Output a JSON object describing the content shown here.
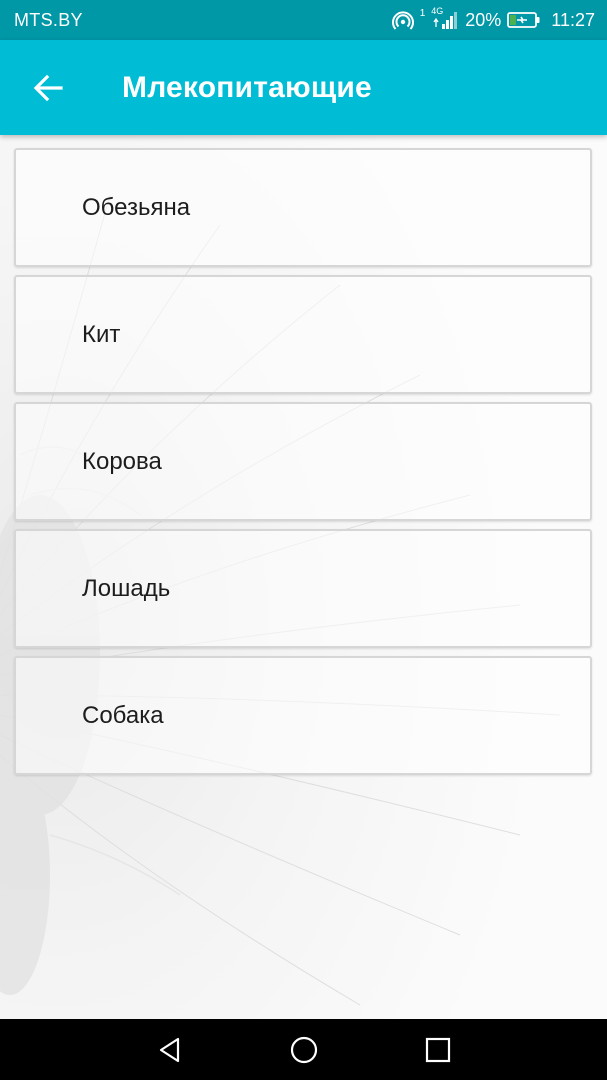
{
  "status_bar": {
    "carrier": "MTS.BY",
    "sim_indicator": "1",
    "network_type": "4G",
    "battery_percent": "20%",
    "time": "11:27",
    "icons": [
      "hotspot-icon",
      "signal-icon",
      "battery-charging-icon"
    ]
  },
  "app_bar": {
    "title": "Млекопитающие",
    "back_icon": "arrow-left-icon",
    "color": "#00bcd4"
  },
  "list": {
    "items": [
      {
        "label": "Обезьяна"
      },
      {
        "label": "Кит"
      },
      {
        "label": "Корова"
      },
      {
        "label": "Лошадь"
      },
      {
        "label": "Собака"
      }
    ]
  },
  "nav_bar": {
    "icons": [
      "back-triangle-icon",
      "home-circle-icon",
      "recents-square-icon"
    ]
  },
  "colors": {
    "status_bar": "#0097a7",
    "app_bar": "#00bcd4",
    "nav_bar": "#000000"
  }
}
